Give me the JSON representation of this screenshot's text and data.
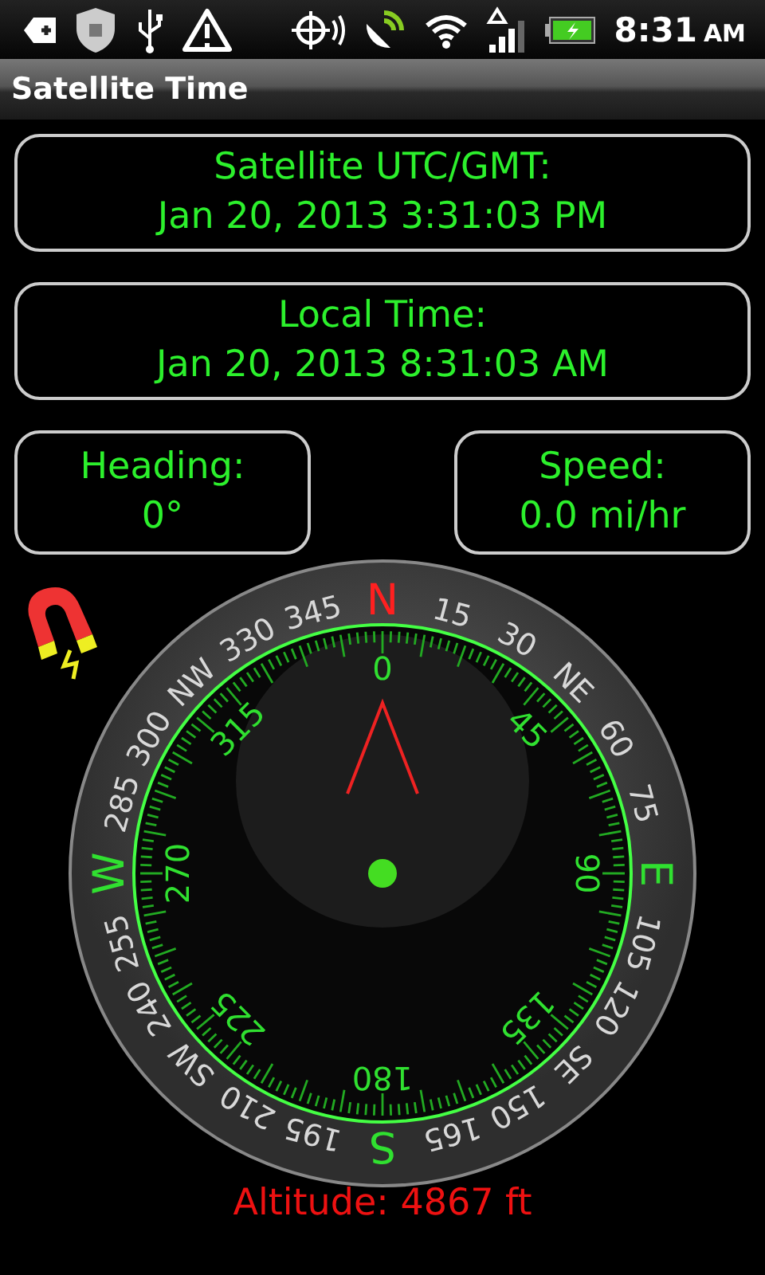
{
  "status_bar": {
    "time": "8:31",
    "ampm": "AM"
  },
  "title_bar": {
    "title": "Satellite Time"
  },
  "time_panels": [
    {
      "label": "Satellite UTC/GMT:",
      "value": "Jan 20, 2013 3:31:03 PM"
    },
    {
      "label": "Local Time:",
      "value": "Jan 20, 2013 8:31:03 AM"
    }
  ],
  "readouts": [
    {
      "label": "Heading:",
      "value": "0°"
    },
    {
      "label": "Speed:",
      "value": "0.0 mi/hr"
    }
  ],
  "compass": {
    "ring_labels": [
      {
        "text": "N",
        "color": "#ff2020"
      },
      {
        "text": "15",
        "color": "#d8d8d8"
      },
      {
        "text": "30",
        "color": "#d8d8d8"
      },
      {
        "text": "NE",
        "color": "#d8d8d8"
      },
      {
        "text": "60",
        "color": "#d8d8d8"
      },
      {
        "text": "75",
        "color": "#d8d8d8"
      },
      {
        "text": "E",
        "color": "#30e030"
      },
      {
        "text": "105",
        "color": "#d8d8d8"
      },
      {
        "text": "120",
        "color": "#d8d8d8"
      },
      {
        "text": "SE",
        "color": "#d8d8d8"
      },
      {
        "text": "150",
        "color": "#d8d8d8"
      },
      {
        "text": "165",
        "color": "#d8d8d8"
      },
      {
        "text": "S",
        "color": "#30e030"
      },
      {
        "text": "195",
        "color": "#d8d8d8"
      },
      {
        "text": "210",
        "color": "#d8d8d8"
      },
      {
        "text": "SW",
        "color": "#d8d8d8"
      },
      {
        "text": "240",
        "color": "#d8d8d8"
      },
      {
        "text": "255",
        "color": "#d8d8d8"
      },
      {
        "text": "W",
        "color": "#30e030"
      },
      {
        "text": "285",
        "color": "#d8d8d8"
      },
      {
        "text": "300",
        "color": "#d8d8d8"
      },
      {
        "text": "NW",
        "color": "#d8d8d8"
      },
      {
        "text": "330",
        "color": "#d8d8d8"
      },
      {
        "text": "345",
        "color": "#d8d8d8"
      }
    ],
    "dial_labels": [
      "0",
      "45",
      "90",
      "135",
      "180",
      "225",
      "270",
      "315"
    ]
  },
  "altitude": "Altitude: 4867 ft"
}
